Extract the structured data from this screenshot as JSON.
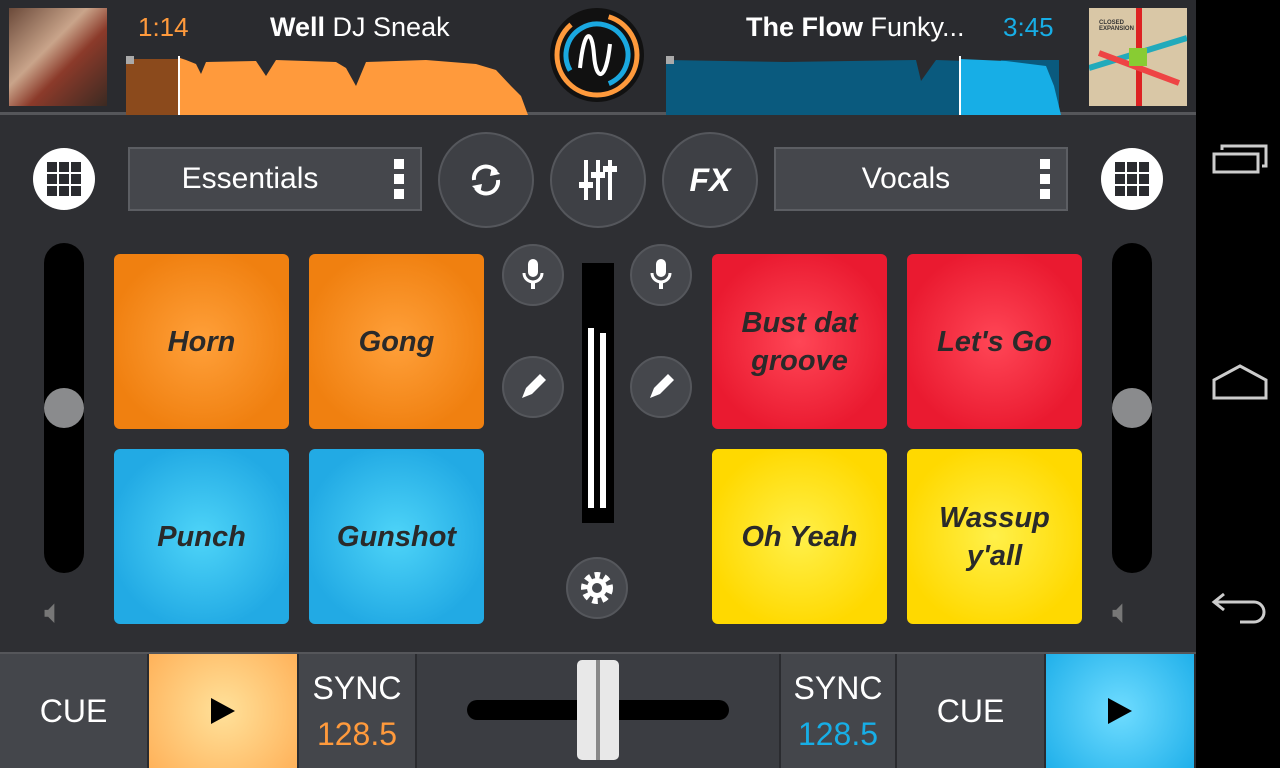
{
  "deck_left": {
    "time": "1:14",
    "title": "Well",
    "artist": "DJ Sneak",
    "sampler_bank": "Essentials",
    "bpm": "128.5",
    "cue_label": "CUE",
    "sync_label": "SYNC",
    "color": "#ff9a3c",
    "progress": 0.13
  },
  "deck_right": {
    "time": "3:45",
    "title": "The Flow",
    "artist": "Funky...",
    "sampler_bank": "Vocals",
    "bpm": "128.5",
    "cue_label": "CUE",
    "sync_label": "SYNC",
    "color": "#17aee6",
    "progress": 0.75,
    "album_text": "CLOSED EXPANSION"
  },
  "center": {
    "fx_label": "FX"
  },
  "pads_left": [
    "Horn",
    "Gong",
    "Punch",
    "Gunshot"
  ],
  "pads_right": [
    "Bust dat groove",
    "Let's Go",
    "Oh Yeah",
    "Wassup y'all"
  ],
  "volume_left": 0.5,
  "volume_right": 0.5,
  "crossfader": 0.5
}
